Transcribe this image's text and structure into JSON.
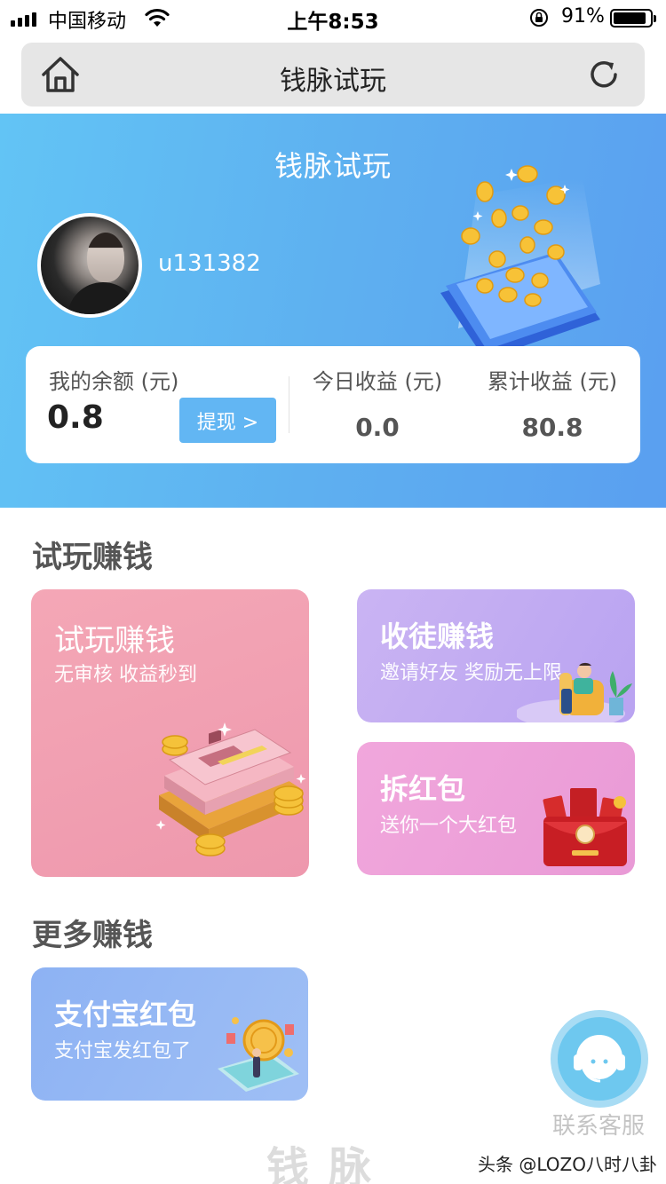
{
  "status_bar": {
    "carrier": "中国移动",
    "time": "上午8:53",
    "battery_percent": "91%",
    "battery_level": 0.91
  },
  "nav": {
    "title": "钱脉试玩",
    "home_icon": "home-icon",
    "refresh_icon": "refresh-icon"
  },
  "hero": {
    "title": "钱脉试玩",
    "username": "u131382"
  },
  "balance": {
    "balance_label": "我的余额 (元)",
    "balance_value": "0.8",
    "withdraw_label": "提现 >",
    "today_label": "今日收益 (元)",
    "today_value": "0.0",
    "total_label": "累计收益 (元)",
    "total_value": "80.8"
  },
  "section_trial": {
    "title": "试玩赚钱",
    "cards": [
      {
        "title": "试玩赚钱",
        "subtitle": "无审核 收益秒到"
      },
      {
        "title": "收徒赚钱",
        "subtitle": "邀请好友 奖励无上限"
      },
      {
        "title": "拆红包",
        "subtitle": "送你一个大红包"
      }
    ]
  },
  "section_more": {
    "title": "更多赚钱",
    "cards": [
      {
        "title": "支付宝红包",
        "subtitle": "支付宝发红包了"
      }
    ]
  },
  "service": {
    "label": "联系客服"
  },
  "footer": {
    "brand": "钱脉",
    "watermark": "头条 @LOZO八时八卦"
  },
  "colors": {
    "hero_start": "#62c4f5",
    "hero_end": "#5a9ff0",
    "withdraw_button": "#62b6f3",
    "card_trial": "#f4a7b6",
    "card_invite": "#cab4f3",
    "card_redpack": "#f1a7dc",
    "card_alipay": "#8db2f3"
  }
}
